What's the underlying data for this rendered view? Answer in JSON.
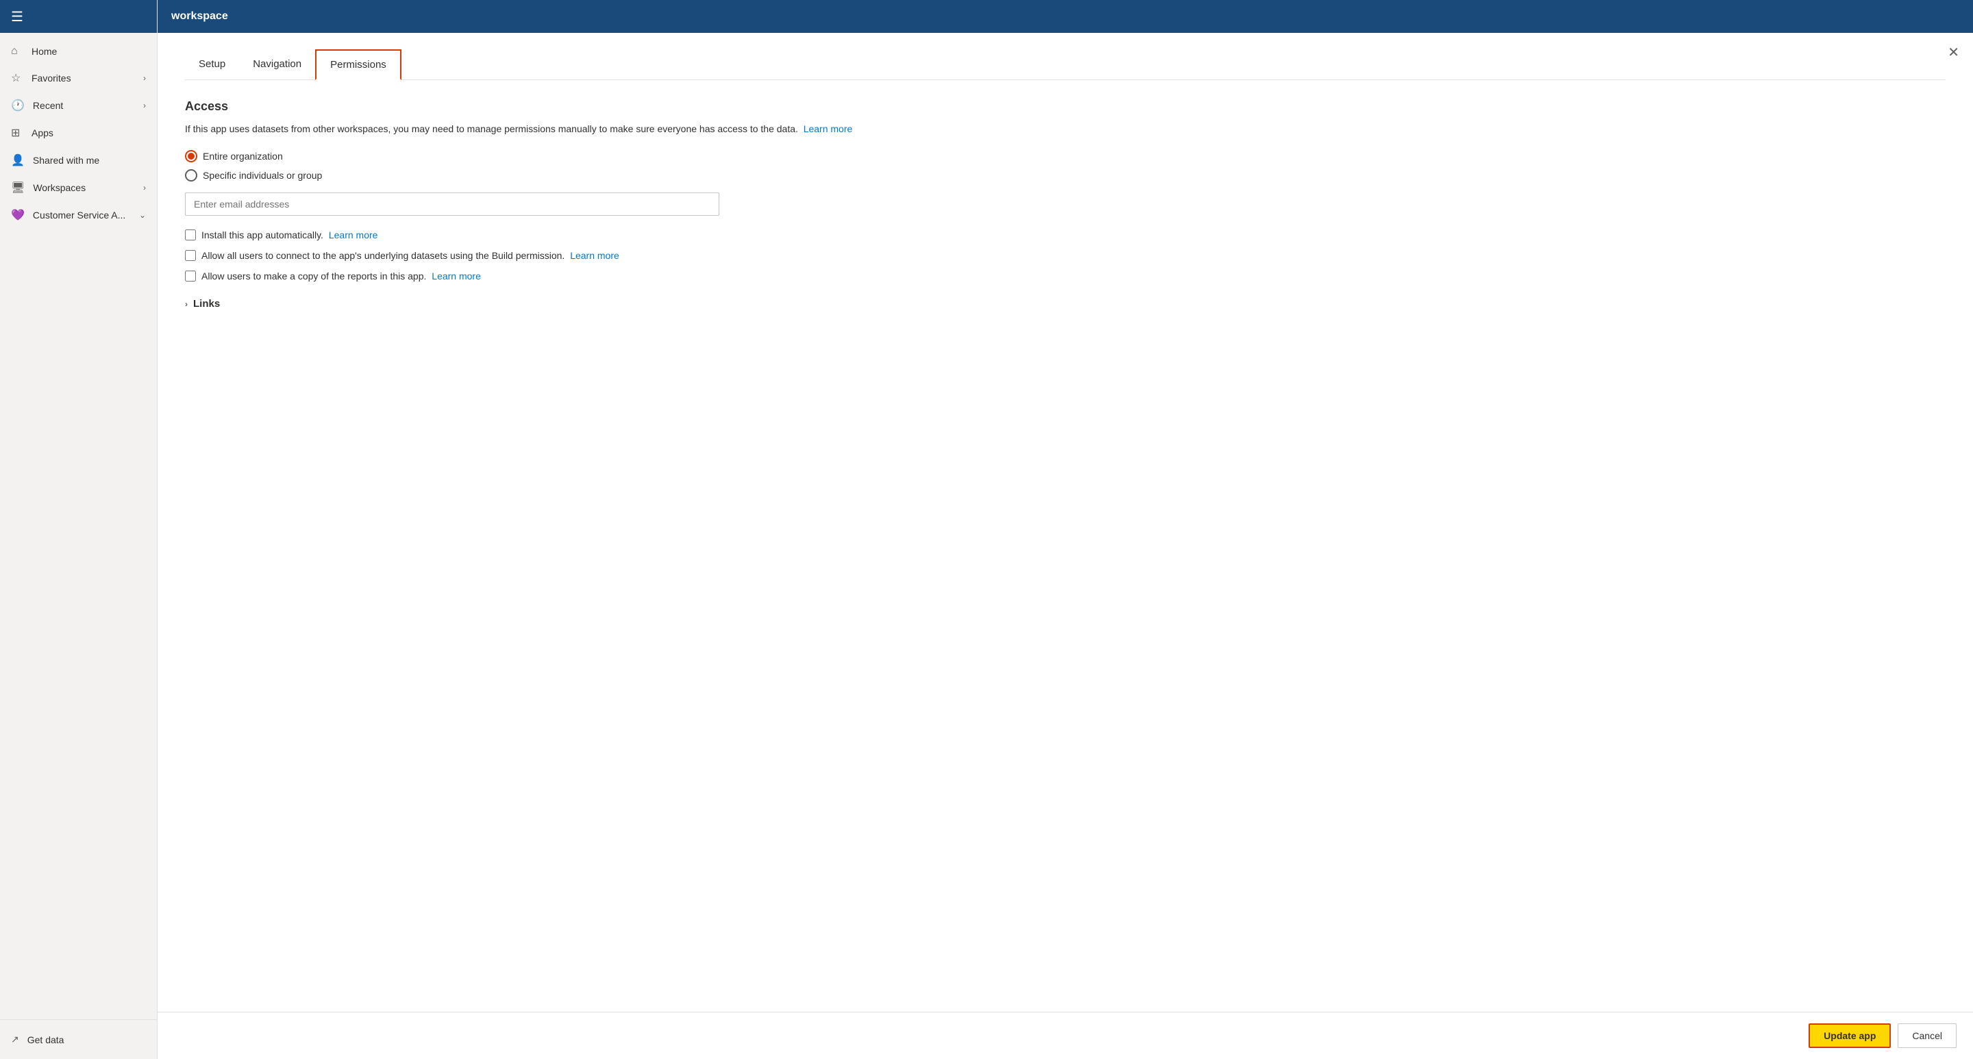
{
  "sidebar": {
    "title": "workspace",
    "items": [
      {
        "id": "home",
        "label": "Home",
        "icon": "⌂",
        "hasArrow": false
      },
      {
        "id": "favorites",
        "label": "Favorites",
        "icon": "☆",
        "hasArrow": true
      },
      {
        "id": "recent",
        "label": "Recent",
        "icon": "🕐",
        "hasArrow": true
      },
      {
        "id": "apps",
        "label": "Apps",
        "icon": "⊞",
        "hasArrow": false
      },
      {
        "id": "shared",
        "label": "Shared with me",
        "icon": "👥",
        "hasArrow": false
      },
      {
        "id": "workspaces",
        "label": "Workspaces",
        "icon": "🖥",
        "hasArrow": true
      },
      {
        "id": "customer",
        "label": "Customer Service A...",
        "icon": "💜",
        "hasArrow": true,
        "isWorkspace": true
      }
    ],
    "footer": {
      "label": "Get data",
      "icon": "↗"
    }
  },
  "topbar": {
    "title": "workspace"
  },
  "tabs": [
    {
      "id": "setup",
      "label": "Setup",
      "active": false
    },
    {
      "id": "navigation",
      "label": "Navigation",
      "active": false
    },
    {
      "id": "permissions",
      "label": "Permissions",
      "active": true
    }
  ],
  "permissions": {
    "section_title": "Access",
    "description": "If this app uses datasets from other workspaces, you may need to manage permissions manually to make sure everyone has access to the data.",
    "learn_more_1": "Learn more",
    "radio_options": [
      {
        "id": "entire_org",
        "label": "Entire organization",
        "selected": true
      },
      {
        "id": "specific",
        "label": "Specific individuals or group",
        "selected": false
      }
    ],
    "email_placeholder": "Enter email addresses",
    "checkboxes": [
      {
        "id": "install_auto",
        "label": "Install this app automatically.",
        "checked": false,
        "has_link": true,
        "link_text": "Learn more"
      },
      {
        "id": "allow_build",
        "label": "Allow all users to connect to the app's underlying datasets using the Build permission.",
        "checked": false,
        "has_link": true,
        "link_text": "Learn more"
      },
      {
        "id": "allow_copy",
        "label": "Allow users to make a copy of the reports in this app.",
        "checked": false,
        "has_link": true,
        "link_text": "Learn more"
      }
    ],
    "links_label": "Links"
  },
  "actions": {
    "update_label": "Update app",
    "cancel_label": "Cancel"
  }
}
